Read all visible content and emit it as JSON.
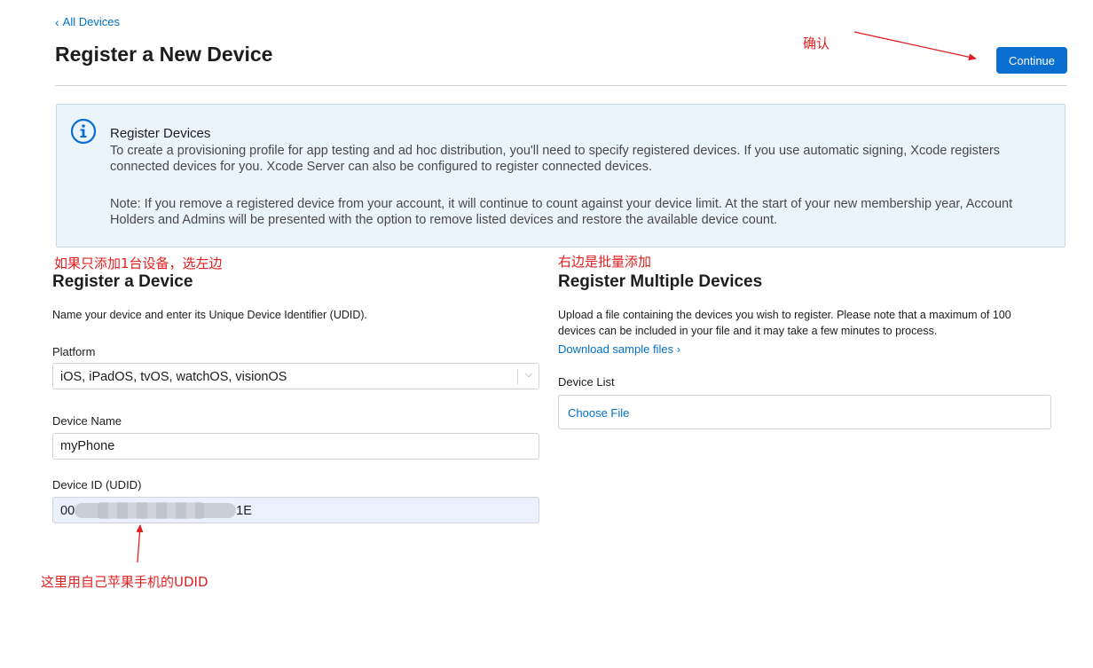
{
  "header": {
    "back_link": "All Devices",
    "title": "Register a New Device",
    "continue_label": "Continue"
  },
  "info": {
    "title": "Register Devices",
    "paragraph1": "To create a provisioning profile for app testing and ad hoc distribution, you'll need to specify registered devices. If you use automatic signing, Xcode registers connected devices for you. Xcode Server can also be configured to register connected devices.",
    "paragraph2": "Note: If you remove a registered device from your account, it will continue to count against your device limit. At the start of your new membership year, Account Holders and Admins will be presented with the option to remove listed devices and restore the available device count.",
    "icon": "info-icon"
  },
  "single": {
    "title": "Register a Device",
    "description": "Name your device and enter its Unique Device Identifier (UDID).",
    "platform_label": "Platform",
    "platform_value": "iOS, iPadOS, tvOS, watchOS, visionOS",
    "name_label": "Device Name",
    "name_value": "myPhone",
    "udid_label": "Device ID (UDID)",
    "udid_prefix": "00",
    "udid_suffix": "1E"
  },
  "multiple": {
    "title": "Register Multiple Devices",
    "description": "Upload a file containing the devices you wish to register. Please note that a maximum of 100 devices can be included in your file and it may take a few minutes to process.",
    "sample_link": "Download sample files",
    "list_label": "Device List",
    "choose_file": "Choose File"
  },
  "annotations": {
    "confirm": "确认",
    "single_hint": "如果只添加1台设备，选左边",
    "batch_hint": "右边是批量添加",
    "udid_hint": "这里用自己苹果手机的UDID",
    "color": "#e02020"
  },
  "colors": {
    "accent": "#0a6fd1",
    "link": "#0070c9",
    "info_bg": "#ebf3fb"
  }
}
